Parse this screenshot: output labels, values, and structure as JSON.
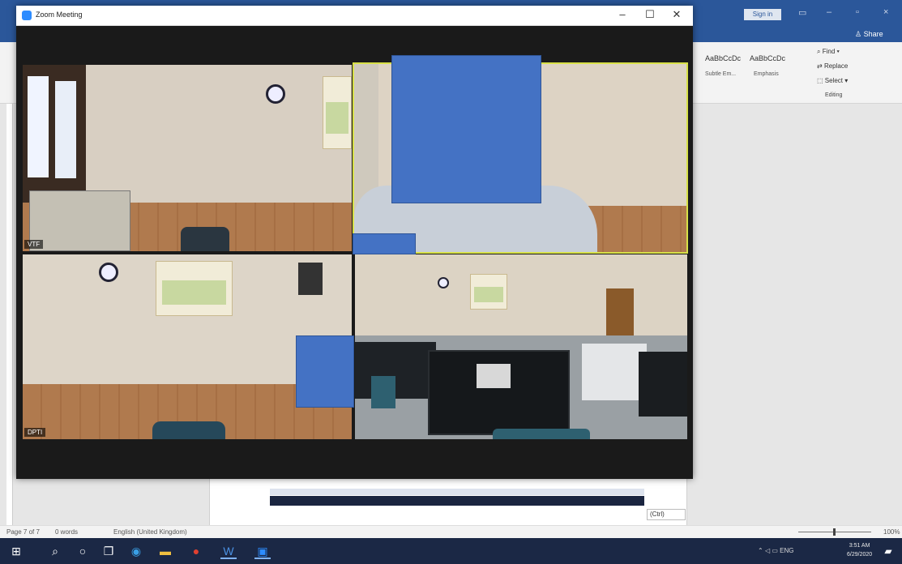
{
  "word": {
    "signin_label": "Sign in",
    "share_label": "Share",
    "styles": [
      {
        "sample": "AaBbCcDc",
        "caption": "Subtle Em..."
      },
      {
        "sample": "AaBbCcDc",
        "caption": "Emphasis"
      }
    ],
    "editing": {
      "find": "Find",
      "replace": "Replace",
      "select": "Select",
      "group_label": "Editing"
    },
    "paste_badge": "(Ctrl)",
    "status": {
      "page": "Page 7 of 7",
      "words": "0 words",
      "language": "English (United Kingdom)",
      "zoom": "100%"
    }
  },
  "zoom": {
    "window_title": "Zoom Meeting",
    "tiles": [
      {
        "name": "VTF"
      },
      {
        "name": ""
      },
      {
        "name": "DPTI"
      },
      {
        "name": ""
      }
    ]
  },
  "taskbar": {
    "tray_lang": "ENG",
    "time": "3:51 AM",
    "date": "6/29/2020"
  },
  "colors": {
    "word_blue": "#2b579a",
    "zoom_blue": "#2d8cff",
    "redaction": "#4472c4",
    "taskbar": "#1b2845",
    "active_speaker": "#d8e048"
  }
}
